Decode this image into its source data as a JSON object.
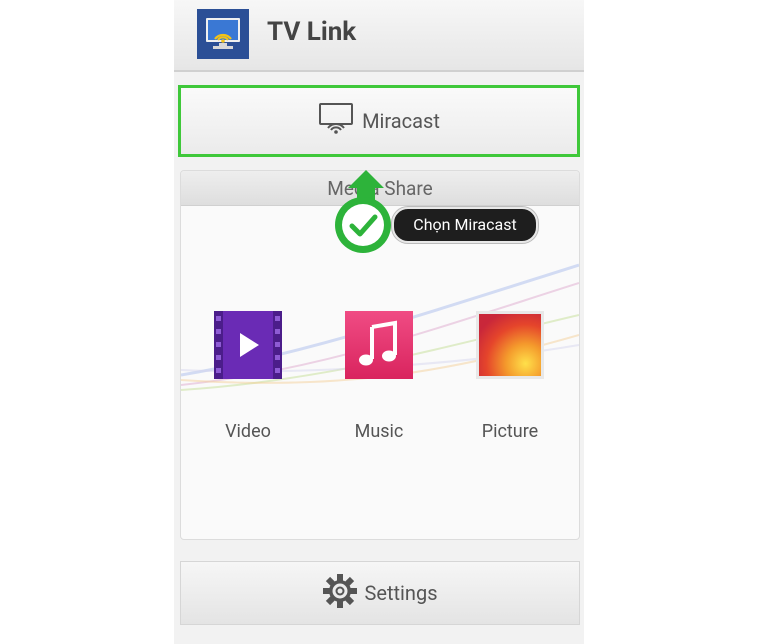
{
  "app": {
    "title": "TV Link",
    "icon": "tv-wifi-icon"
  },
  "miracast": {
    "label": "Miracast",
    "icon": "screen-mirror-icon",
    "highlight_color": "#3fc83a"
  },
  "media_share": {
    "title": "Media Share",
    "items": [
      {
        "label": "Video",
        "icon": "video-play-icon",
        "color": "#6a2bb5"
      },
      {
        "label": "Music",
        "icon": "music-note-icon",
        "color": "#e8336f"
      },
      {
        "label": "Picture",
        "icon": "picture-gradient-icon",
        "color": "#f0742c"
      }
    ]
  },
  "settings": {
    "label": "Settings",
    "icon": "gear-icon"
  },
  "callout": {
    "text": "Chọn Miracast",
    "icon": "check-circle-icon",
    "color": "#2db33a"
  }
}
